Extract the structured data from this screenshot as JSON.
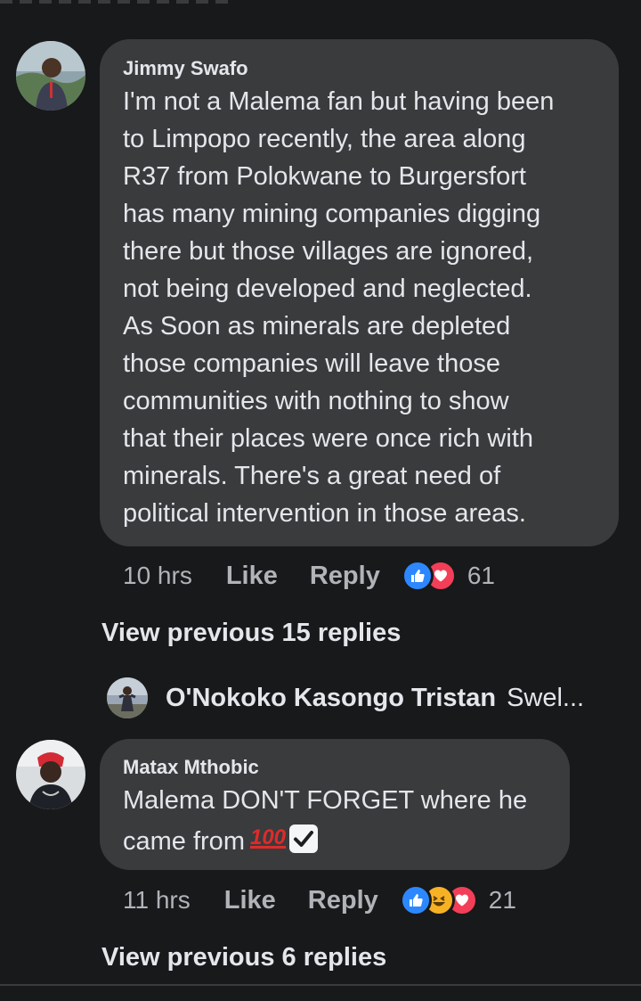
{
  "comments": [
    {
      "author": "Jimmy Swafo",
      "text": "I'm not a Malema fan but having been\nto Limpopo recently, the area along\nR37 from Polokwane to Burgersfort\nhas many mining companies digging\nthere but those villages are ignored,\nnot being developed and neglected.\nAs Soon as minerals are depleted\nthose companies will leave those\ncommunities with nothing to show\nthat their places were once rich with\nminerals. There's a great need of\npolitical intervention in those areas.",
      "time": "10 hrs",
      "like_label": "Like",
      "reply_label": "Reply",
      "reactions": [
        "like-icon",
        "love-icon"
      ],
      "reaction_count": "61",
      "view_previous": "View previous 15 replies",
      "reply_preview": {
        "name": "O'Nokoko Kasongo Tristan",
        "text": "Swel..."
      }
    },
    {
      "author": "Matax Mthobic",
      "text": "Malema DON'T FORGET where he\ncame from",
      "emoji_hundred": "100",
      "emoji_check": "check-mark-icon",
      "time": "11 hrs",
      "like_label": "Like",
      "reply_label": "Reply",
      "reactions": [
        "like-icon",
        "haha-icon",
        "love-icon"
      ],
      "reaction_count": "21",
      "view_previous": "View previous 6 replies"
    }
  ],
  "colors": {
    "background": "#18191a",
    "bubble": "#3a3b3c",
    "primary_text": "#e4e6eb",
    "secondary_text": "#b0b3b8",
    "like_blue": "#2d88ff",
    "love_red": "#f33e58",
    "haha_yellow": "#f7b125"
  }
}
